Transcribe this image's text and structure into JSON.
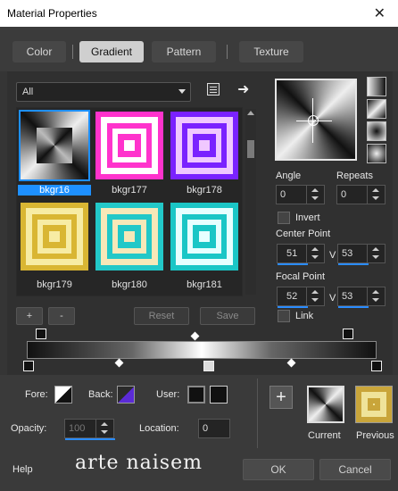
{
  "window": {
    "title": "Material Properties",
    "close_glyph": "✕"
  },
  "tabs": [
    {
      "label": "Color"
    },
    {
      "label": "Gradient"
    },
    {
      "label": "Pattern"
    },
    {
      "label": "Texture"
    }
  ],
  "category": {
    "value": "All"
  },
  "thumbnails": [
    {
      "label": "bkgr16",
      "colors": [
        "#111111",
        "#f0f0f0"
      ]
    },
    {
      "label": "bkgr177",
      "colors": [
        "#ff33cc",
        "#ffffff"
      ]
    },
    {
      "label": "bkgr178",
      "colors": [
        "#7a22ff",
        "#f0c8ff"
      ]
    },
    {
      "label": "bkgr179",
      "colors": [
        "#d9b633",
        "#f7eca4"
      ]
    },
    {
      "label": "bkgr180",
      "colors": [
        "#22c8c8",
        "#f7e8b8"
      ]
    },
    {
      "label": "bkgr181",
      "colors": [
        "#1ac6c6",
        "#e6ffff"
      ]
    }
  ],
  "list_buttons": {
    "add": "+",
    "remove": "-",
    "reset": "Reset",
    "save": "Save"
  },
  "angle": {
    "label": "Angle",
    "value": "0"
  },
  "repeats": {
    "label": "Repeats",
    "value": "0"
  },
  "invert": {
    "label": "Invert"
  },
  "center_point": {
    "label": "Center Point",
    "h_label": "H",
    "h": "51",
    "v_label": "V",
    "v": "53"
  },
  "focal_point": {
    "label": "Focal Point",
    "h_label": "H",
    "h": "52",
    "v_label": "V",
    "v": "53"
  },
  "link": {
    "label": "Link"
  },
  "fore": {
    "label": "Fore:"
  },
  "back": {
    "label": "Back:"
  },
  "user": {
    "label": "User:"
  },
  "opacity": {
    "label": "Opacity:",
    "value": "100"
  },
  "location": {
    "label": "Location:",
    "value": "0"
  },
  "current": {
    "label": "Current"
  },
  "previous": {
    "label": "Previous"
  },
  "help": {
    "label": "Help"
  },
  "watermark": {
    "text": "arte naisem"
  },
  "ok": {
    "label": "OK"
  },
  "cancel": {
    "label": "Cancel"
  }
}
